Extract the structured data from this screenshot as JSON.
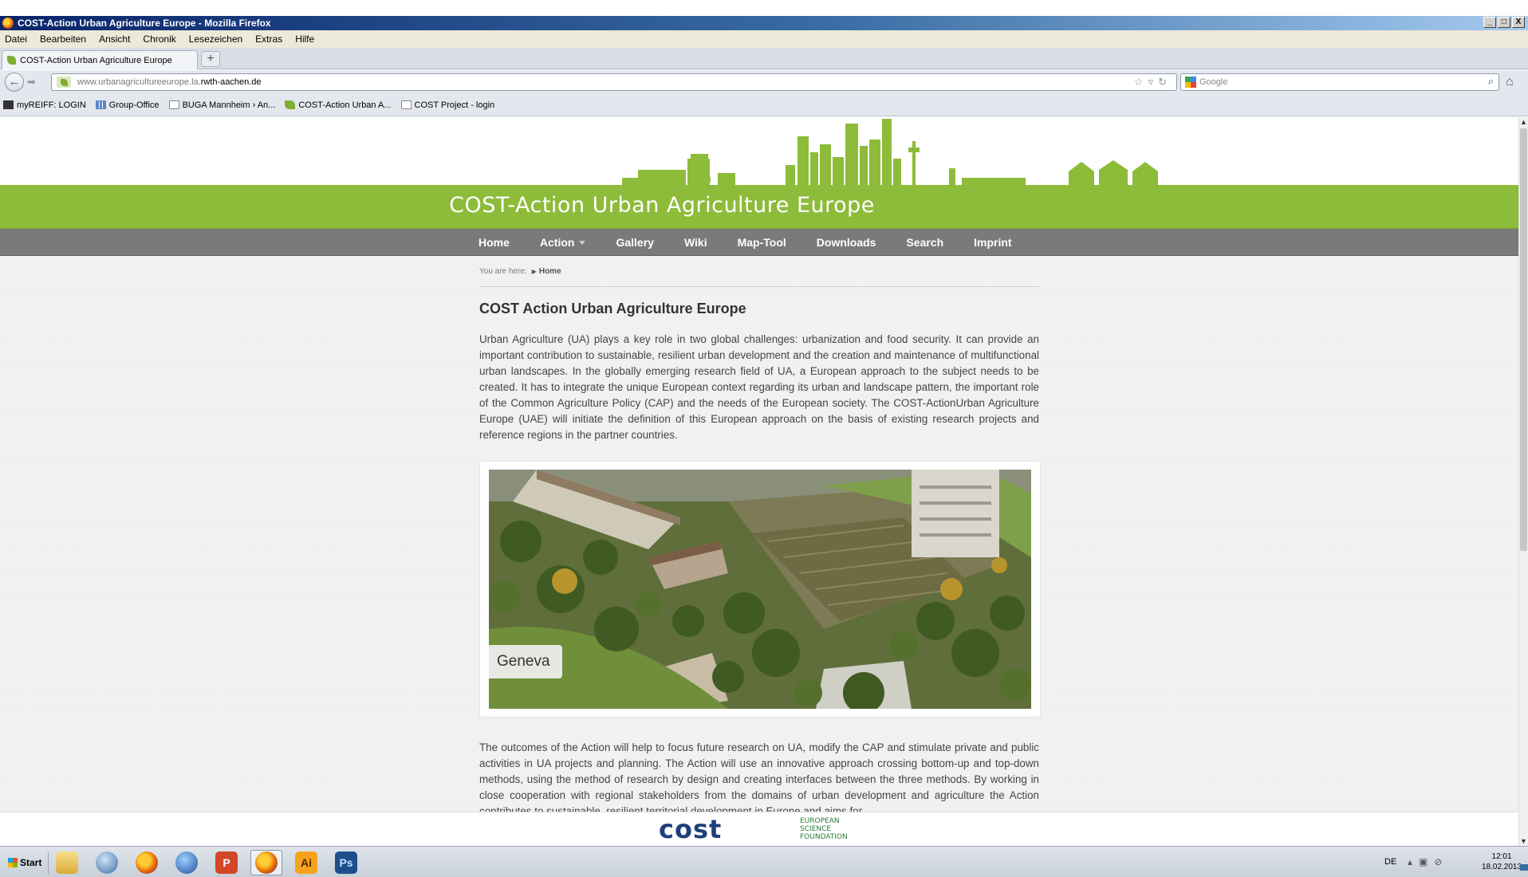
{
  "browser": {
    "window_title": "COST-Action Urban Agriculture Europe - Mozilla Firefox",
    "window_buttons": [
      "_",
      "□",
      "X"
    ],
    "menu": [
      "Datei",
      "Bearbeiten",
      "Ansicht",
      "Chronik",
      "Lesezeichen",
      "Extras",
      "Hilfe"
    ],
    "tab_title": "COST-Action Urban Agriculture Europe",
    "new_tab_label": "+",
    "url_prefix": "www.urbanagricultureeurope.la.",
    "url_domain": "rwth-aachen.de",
    "search_placeholder": "Google",
    "bookmarks": [
      {
        "label": "myREIFF: LOGIN",
        "icon": "myreiff-icon"
      },
      {
        "label": "Group-Office",
        "icon": "group-office-icon"
      },
      {
        "label": "BUGA Mannheim › An...",
        "icon": "page-icon"
      },
      {
        "label": "COST-Action Urban A...",
        "icon": "leaf-icon"
      },
      {
        "label": "COST Project - login",
        "icon": "page-icon"
      }
    ]
  },
  "site": {
    "title": "COST-Action Urban Agriculture Europe",
    "nav": [
      {
        "label": "Home"
      },
      {
        "label": "Action",
        "has_dropdown": true
      },
      {
        "label": "Gallery"
      },
      {
        "label": "Wiki"
      },
      {
        "label": "Map-Tool"
      },
      {
        "label": "Downloads"
      },
      {
        "label": "Search"
      },
      {
        "label": "Imprint"
      }
    ],
    "breadcrumb_prefix": "You are here:",
    "breadcrumb_current": "Home",
    "page_title": "COST Action Urban Agriculture Europe",
    "intro": "Urban Agriculture (UA) plays a key role in two global challenges: urbanization and food security. It can provide an important contribution to sustainable, resilient urban development and the creation and maintenance of multifunctional urban landscapes. In the globally emerging research field of UA, a European approach to the subject needs to be created. It has to integrate the unique European context regarding its urban and landscape pattern, the important role of the Common Agriculture Policy (CAP) and the needs of the European society. The COST-ActionUrban Agriculture Europe (UAE) will initiate the definition of this European approach on the basis of existing research projects and reference regions in the partner countries.",
    "photo_caption": "Geneva",
    "second_paragraph": "The outcomes of the Action will help to focus future research on UA, modify the CAP and stimulate private and public activities in UA projects and planning. The Action will use an innovative approach crossing bottom-up and top-down methods, using the method of research by design and creating interfaces between the three methods. By working in close cooperation with regional stakeholders from the domains of urban development and agriculture the Action contributes to sustainable, resilient territorial development in Europe and aims for",
    "footer_logo_cost": "cost",
    "footer_logo_esf": [
      "EUROPEAN",
      "SCIENCE",
      "FOUNDATION"
    ],
    "accent_green": "#8dbb3a",
    "nav_gray": "#7a7a7a"
  },
  "taskbar": {
    "start_label": "Start",
    "apps": [
      {
        "name": "explorer-icon",
        "glyph": ""
      },
      {
        "name": "thunderbird-icon",
        "glyph": ""
      },
      {
        "name": "firefox-icon",
        "glyph": ""
      },
      {
        "name": "google-earth-icon",
        "glyph": ""
      },
      {
        "name": "powerpoint-icon",
        "glyph": "P"
      },
      {
        "name": "firefox-active-icon",
        "glyph": ""
      },
      {
        "name": "illustrator-icon",
        "glyph": "Ai"
      },
      {
        "name": "photoshop-icon",
        "glyph": "Ps"
      }
    ],
    "language": "DE",
    "time": "12:01",
    "date": "18.02.2013"
  }
}
